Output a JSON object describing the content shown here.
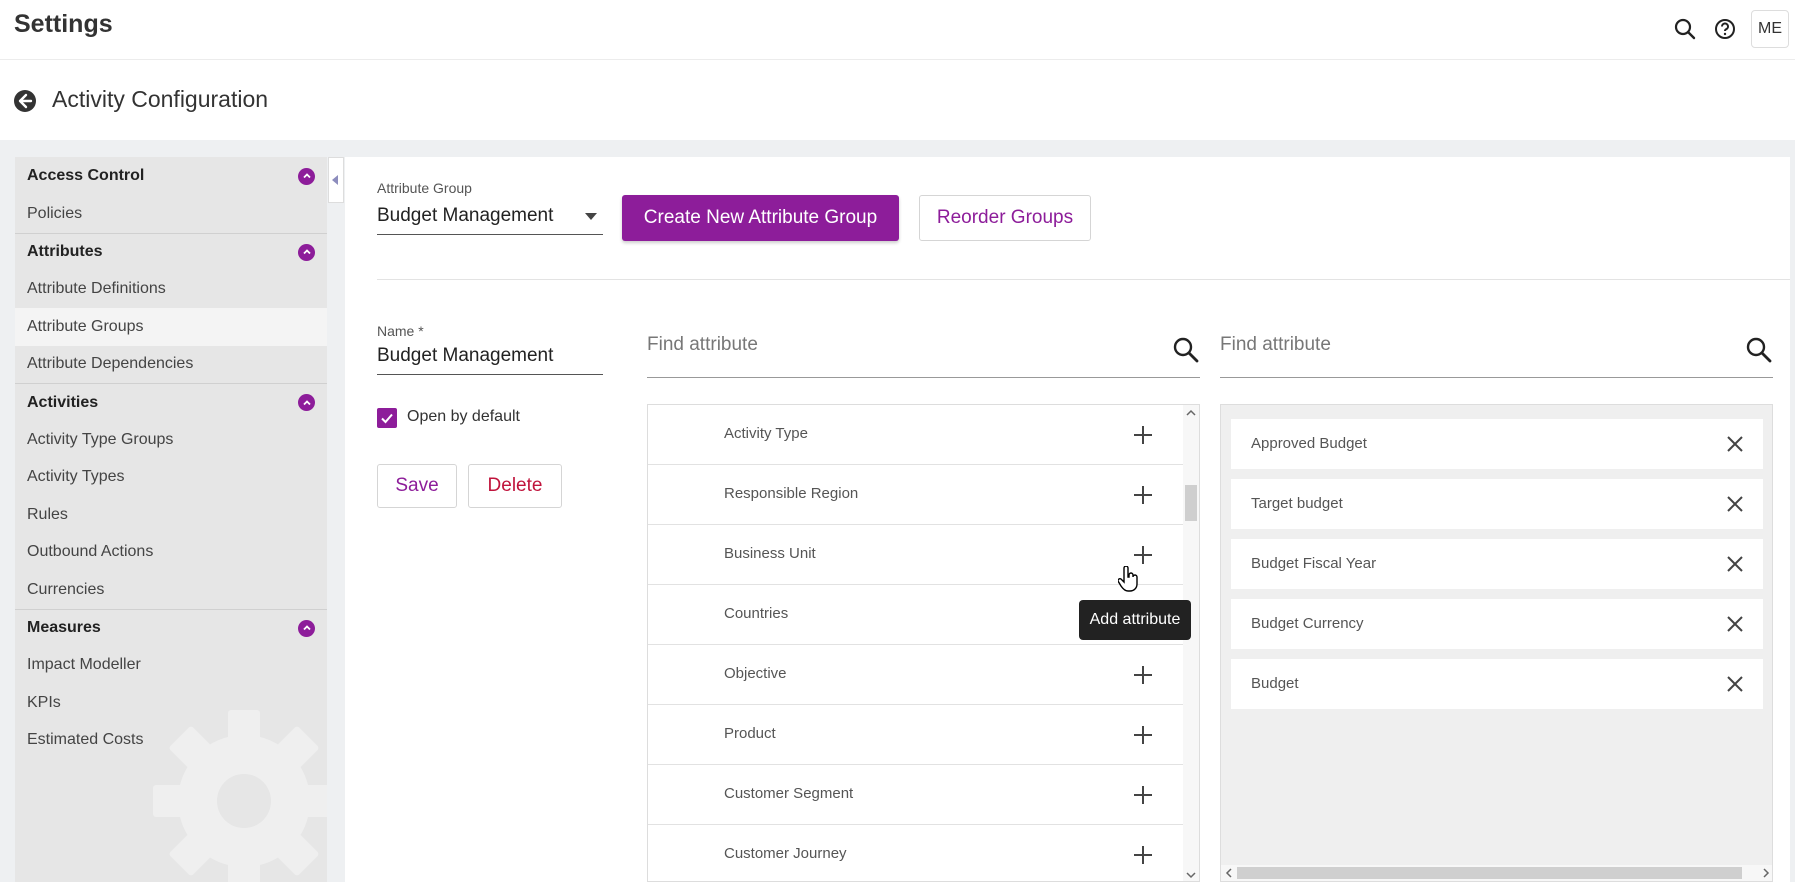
{
  "header": {
    "title": "Settings",
    "avatar_initials": "ME",
    "icons": [
      "search-icon",
      "help-icon"
    ]
  },
  "page": {
    "title": "Activity Configuration"
  },
  "sidebar": {
    "sections": [
      {
        "label": "Access Control",
        "items": [
          "Policies"
        ]
      },
      {
        "label": "Attributes",
        "items": [
          "Attribute Definitions",
          "Attribute Groups",
          "Attribute Dependencies"
        ]
      },
      {
        "label": "Activities",
        "items": [
          "Activity Type Groups",
          "Activity Types",
          "Rules",
          "Outbound Actions",
          "Currencies"
        ]
      },
      {
        "label": "Measures",
        "items": [
          "Impact Modeller",
          "KPIs",
          "Estimated Costs"
        ]
      }
    ],
    "active_item": "Attribute Groups"
  },
  "attribute_group": {
    "label": "Attribute Group",
    "selected": "Budget Management",
    "create_button": "Create New Attribute Group",
    "reorder_button": "Reorder Groups"
  },
  "form": {
    "name_label": "Name *",
    "name_value": "Budget Management",
    "open_by_default_label": "Open by default",
    "open_by_default": true,
    "save_button": "Save",
    "delete_button": "Delete"
  },
  "available": {
    "search_placeholder": "Find attribute",
    "items": [
      "Activity Type",
      "Responsible Region",
      "Business Unit",
      "Countries",
      "Objective",
      "Product",
      "Customer Segment",
      "Customer Journey"
    ],
    "tooltip": "Add attribute"
  },
  "selected": {
    "search_placeholder": "Find attribute",
    "items": [
      "Approved Budget",
      "Target budget",
      "Budget Fiscal Year",
      "Budget Currency",
      "Budget"
    ]
  },
  "colors": {
    "accent": "#8d1d9a",
    "delete": "#c0143c"
  }
}
